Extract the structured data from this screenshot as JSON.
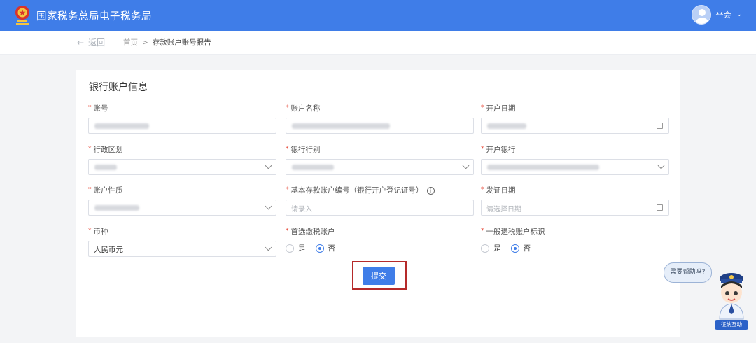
{
  "header": {
    "site_title": "国家税务总局电子税务局",
    "user_name": "**会",
    "caret": "⌄"
  },
  "nav": {
    "back_label": "返回",
    "breadcrumb": [
      "首页",
      "存款账户账号报告"
    ],
    "separator": ">"
  },
  "section": {
    "title": "银行账户信息"
  },
  "fields": {
    "account_no": {
      "label": "账号",
      "required": true
    },
    "account_name": {
      "label": "账户名称",
      "required": true
    },
    "open_date": {
      "label": "开户日期",
      "required": true
    },
    "admin_region": {
      "label": "行政区划",
      "required": true
    },
    "bank_category": {
      "label": "银行行别",
      "required": true
    },
    "open_bank": {
      "label": "开户银行",
      "required": true
    },
    "account_nature": {
      "label": "账户性质",
      "required": true
    },
    "basic_account_no": {
      "label": "基本存款账户编号（银行开户登记证号）",
      "required": true,
      "placeholder": "请录入"
    },
    "issue_date": {
      "label": "发证日期",
      "required": true,
      "placeholder": "请选择日期"
    },
    "currency": {
      "label": "币种",
      "required": true,
      "value": "人民币元"
    },
    "preferred_tax_account": {
      "label": "首选缴税账户",
      "required": true,
      "options": [
        "是",
        "否"
      ],
      "selected": "否"
    },
    "refund_account_flag": {
      "label": "一般退税账户标识",
      "required": true,
      "options": [
        "是",
        "否"
      ],
      "selected": "否"
    }
  },
  "actions": {
    "submit_label": "提交"
  },
  "assistant": {
    "bubble_text": "需要帮助吗?",
    "tag_text": "征纳互动"
  },
  "colors": {
    "primary": "#3f7de8",
    "required": "#e74c3c",
    "highlight_frame": "#b52a2a"
  },
  "icons": {
    "back": "arrow-left-icon",
    "info": "info-circle-icon",
    "calendar": "calendar-icon",
    "dropdown": "chevron-down-icon"
  }
}
